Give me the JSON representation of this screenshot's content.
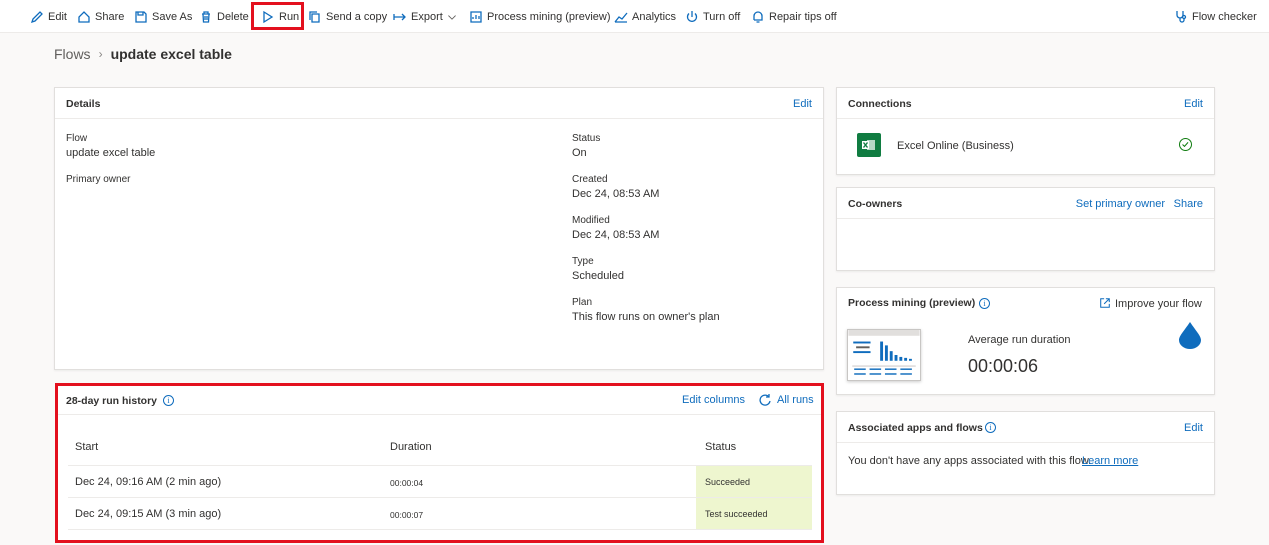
{
  "toolbar": {
    "edit": "Edit",
    "share": "Share",
    "save_as": "Save As",
    "delete": "Delete",
    "run": "Run",
    "send_copy": "Send a copy",
    "export": "Export",
    "process_mining": "Process mining (preview)",
    "analytics": "Analytics",
    "turn_off": "Turn off",
    "repair_tips": "Repair tips off",
    "flow_checker": "Flow checker"
  },
  "breadcrumb": {
    "root": "Flows",
    "current": "update excel table"
  },
  "details": {
    "title": "Details",
    "edit": "Edit",
    "flow_label": "Flow",
    "flow_value": "update excel table",
    "primary_owner_label": "Primary owner",
    "status_label": "Status",
    "status_value": "On",
    "created_label": "Created",
    "created_value": "Dec 24, 08:53 AM",
    "modified_label": "Modified",
    "modified_value": "Dec 24, 08:53 AM",
    "type_label": "Type",
    "type_value": "Scheduled",
    "plan_label": "Plan",
    "plan_value": "This flow runs on owner's plan"
  },
  "run_history": {
    "title": "28-day run history",
    "edit_columns": "Edit columns",
    "all_runs": "All runs",
    "columns": [
      "Start",
      "Duration",
      "Status"
    ],
    "rows": [
      {
        "start": "Dec 24, 09:16 AM (2 min ago)",
        "duration": "00:00:04",
        "status": "Succeeded"
      },
      {
        "start": "Dec 24, 09:15 AM (3 min ago)",
        "duration": "00:00:07",
        "status": "Test succeeded"
      }
    ]
  },
  "connections": {
    "title": "Connections",
    "edit": "Edit",
    "item": "Excel Online (Business)"
  },
  "coowners": {
    "title": "Co-owners",
    "set_primary": "Set primary owner",
    "share": "Share"
  },
  "process_mining": {
    "title": "Process mining (preview)",
    "improve": "Improve your flow",
    "avg_label": "Average run duration",
    "avg_value": "00:00:06"
  },
  "associated": {
    "title": "Associated apps and flows",
    "edit": "Edit",
    "message": "You don't have any apps associated with this flow.",
    "learn_more": "Learn more"
  },
  "colors": {
    "accent": "#0f6cbd",
    "highlight": "#e3101e",
    "success_bg": "#eef6cf",
    "excel": "#107c41"
  }
}
